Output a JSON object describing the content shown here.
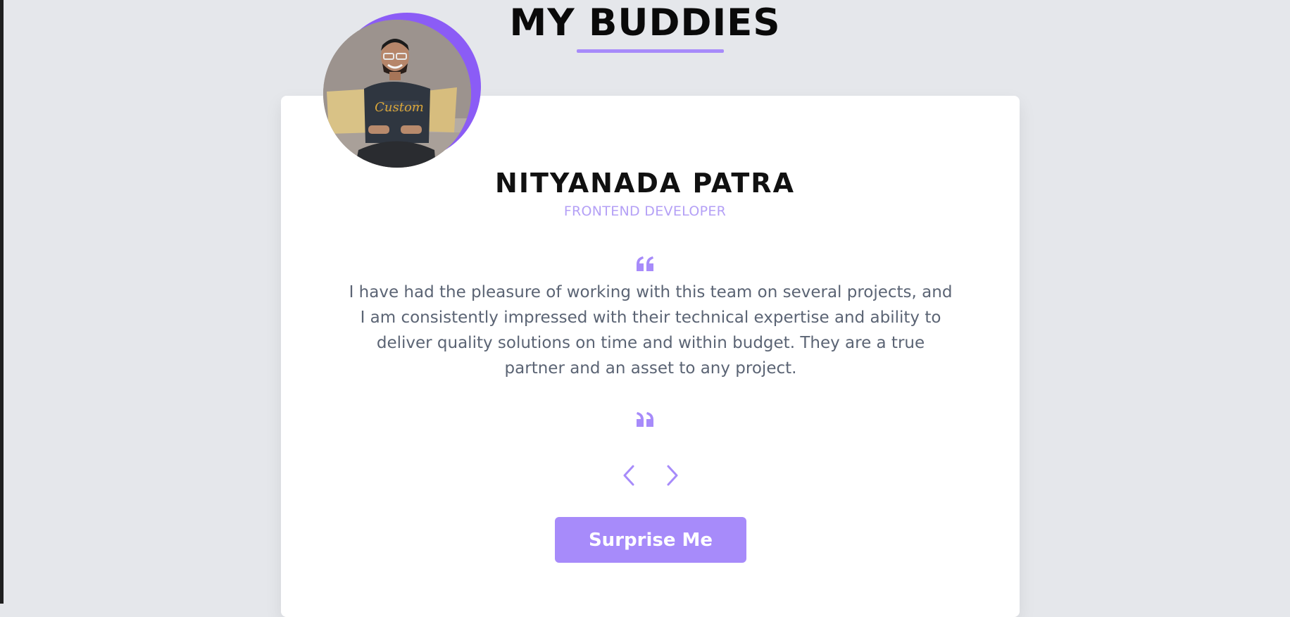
{
  "header": {
    "title": "MY BUDDIES"
  },
  "colors": {
    "accent": "#a78bfa",
    "accent_dark": "#8b5cf6",
    "background": "#e5e7eb",
    "card": "#ffffff",
    "text_muted": "#5b6474"
  },
  "buddy": {
    "name": "NITYANADA PATRA",
    "role": "FRONTEND DEVELOPER",
    "avatar_icon": "person-photo",
    "quote_open_icon": "quote-open-icon",
    "quote_close_icon": "quote-close-icon",
    "testimonial": "I have had the pleasure of working with this team on several projects, and I am consistently impressed with their technical expertise and ability to deliver quality solutions on time and within budget. They are a true partner and an asset to any project."
  },
  "controls": {
    "prev_icon": "chevron-left-icon",
    "next_icon": "chevron-right-icon",
    "surprise_label": "Surprise Me"
  }
}
